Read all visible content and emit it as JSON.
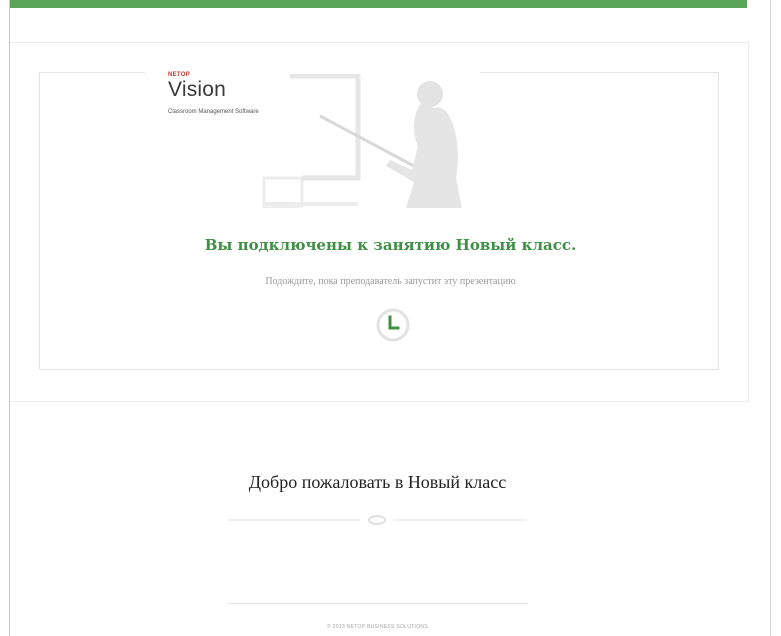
{
  "logo": {
    "brand": "NETOP",
    "product": "Vision",
    "tagline": "Classroom Management Software"
  },
  "status": {
    "connected_message": "Вы подключены к занятию Новый класс.",
    "waiting_message": "Подождите, пока преподаватель запустит эту презентацию"
  },
  "welcome": {
    "title": "Добро пожаловать в Новый класс"
  },
  "footer": {
    "copyright": "© 2013 NETOP BUSINESS SOLUTIONS"
  },
  "icons": {
    "illustration": "teacher-pointer-illustration",
    "waiting": "clock-icon",
    "ornament": "divider-ornament-icon"
  },
  "colors": {
    "accent": "#5aa55a",
    "title_green": "#3f8f45",
    "brand_red": "#c9352b"
  }
}
